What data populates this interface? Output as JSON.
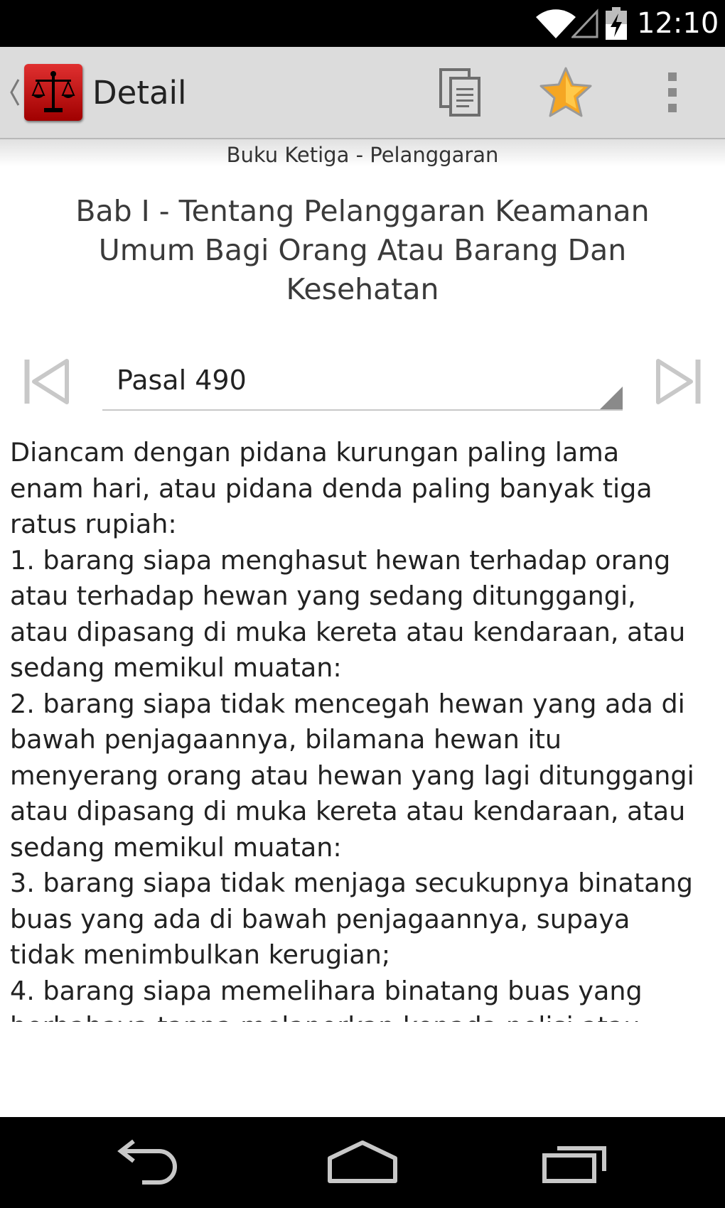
{
  "status_bar": {
    "time": "12:10",
    "icons": [
      "wifi-icon",
      "signal-icon",
      "battery-charging-icon"
    ]
  },
  "action_bar": {
    "title": "Detail",
    "app_icon": "scales-of-justice-icon",
    "actions": [
      "copy-icon",
      "star-icon",
      "overflow-menu-icon"
    ],
    "accent_color": "#d62020",
    "star_color": "#f5a623"
  },
  "content": {
    "book_title": "Buku Ketiga - Pelanggaran",
    "chapter_title": "Bab I - Tentang Pelanggaran Keamanan Umum Bagi Orang Atau Barang Dan Kesehatan",
    "pasal_selected": "Pasal 490",
    "article_lines": [
      "Diancam dengan pidana kurungan paling lama",
      "enam hari, atau pidana denda paling banyak tiga",
      "ratus rupiah:",
      "1. barang siapa menghasut hewan terhadap orang",
      "atau terhadap hewan yang sedang ditunggangi,",
      "atau dipasang di muka kereta atau kendaraan, atau",
      "sedang memikul muatan:",
      "2. barang siapa tidak mencegah hewan yang ada di",
      "bawah penjagaannya, bilamana hewan itu",
      "menyerang orang atau hewan yang lagi ditunggangi",
      "atau dipasang di muka kereta atau kendaraan, atau",
      "sedang memikul muatan:",
      "3. barang siapa tidak menjaga secukupnya binatang",
      "buas yang ada di bawah penjagaannya, supaya",
      "tidak menimbulkan kerugian;",
      "4. barang siapa memelihara binatang buas yang",
      "berbahaya tanpa melaporkan kepada polisi atau"
    ]
  },
  "nav_bar": {
    "keys": [
      "back-icon",
      "home-icon",
      "recent-apps-icon"
    ]
  }
}
